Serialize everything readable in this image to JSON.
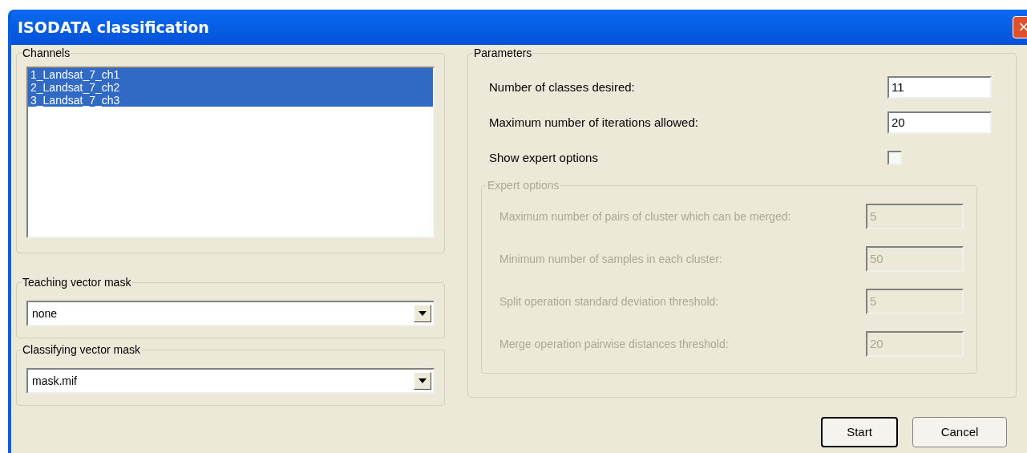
{
  "window": {
    "title": "ISODATA classification",
    "close": "×"
  },
  "channels": {
    "label": "Channels",
    "items": [
      {
        "label": "1_Landsat_7_ch1",
        "selected": true
      },
      {
        "label": "2_Landsat_7_ch2",
        "selected": true
      },
      {
        "label": "3_Landsat_7_ch3",
        "selected": true
      }
    ]
  },
  "teaching_mask": {
    "label": "Teaching vector mask",
    "value": "none"
  },
  "classifying_mask": {
    "label": "Classifying vector mask",
    "value": "mask.mif"
  },
  "parameters": {
    "label": "Parameters",
    "fields": [
      {
        "kind": "text",
        "label": "Number of classes desired:",
        "value": "11"
      },
      {
        "kind": "text",
        "label": "Maximum number of iterations allowed:",
        "value": "20"
      },
      {
        "kind": "checkbox",
        "label": "Show expert options",
        "checked": false
      }
    ]
  },
  "expert_options": {
    "label": "Expert options",
    "disabled": true,
    "fields": [
      {
        "label": "Maximum number of pairs of cluster which can be merged:",
        "value": "5"
      },
      {
        "label": "Minimum number of samples in each cluster:",
        "value": "50"
      },
      {
        "label": "Split operation standard deviation threshold:",
        "value": "5"
      },
      {
        "label": "Merge operation pairwise distances threshold:",
        "value": "20"
      }
    ]
  },
  "buttons": [
    {
      "label": "Start",
      "default": true
    },
    {
      "label": "Cancel",
      "default": false
    }
  ]
}
